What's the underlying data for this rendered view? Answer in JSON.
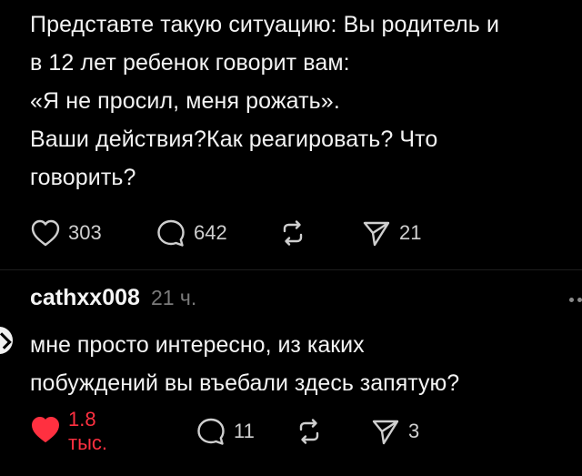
{
  "post": {
    "lines": [
      "Представте такую ситуацию: Вы родитель и",
      "в 12 лет ребенок говорит вам:",
      "«Я не просил, меня рожать».",
      "Ваши действия?Как реагировать? Что",
      "говорить?"
    ],
    "likes": "303",
    "replies": "642",
    "shares": "21"
  },
  "reply": {
    "username": "cathxx008",
    "time": "21 ч.",
    "lines": [
      "мне просто интересно, из каких",
      "побуждений вы въебали здесь запятую?"
    ],
    "likes": "1.8 тыс.",
    "replies": "11",
    "shares": "3",
    "liked": true
  },
  "colors": {
    "like_active": "#ff3040",
    "icon": "#cfcfcf",
    "muted": "#7a7a7a",
    "background": "#000000"
  },
  "icons": {
    "like": "heart-icon",
    "reply": "comment-bubble-icon",
    "repost": "repost-icon",
    "share": "send-icon",
    "more": "more-dots-icon"
  }
}
